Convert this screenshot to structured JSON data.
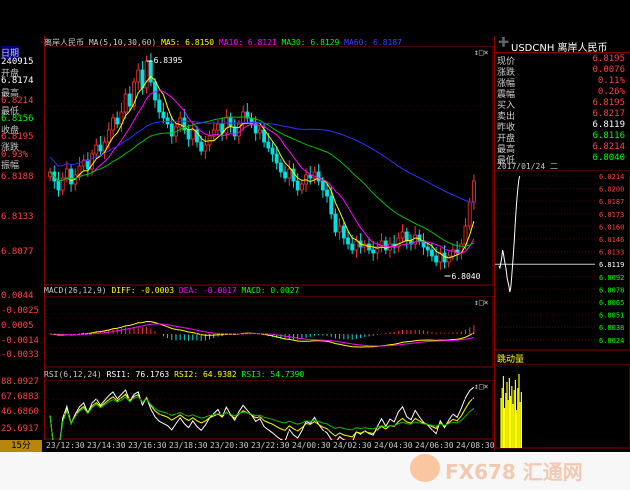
{
  "title_bar": {
    "symbol_name": "离岸人民币"
  },
  "main_header": {
    "name": "离岸人民币",
    "ma_params": "MA(5,10,30,60)",
    "ma5": "MA5: 6.8150",
    "ma10": "MA10: 6.8121",
    "ma30": "MA30: 6.8129",
    "ma60": "MA60: 6.8187"
  },
  "left_panel": {
    "date_label": "日期",
    "date_value": "240915",
    "open_label": "开盘",
    "open_value": "6.8174",
    "high_label": "最高",
    "high_value": "6.8214",
    "low_label": "最低",
    "low_value": "6.8156",
    "close_label": "收盘",
    "close_value": "6.8195",
    "change_label": "涨跌",
    "change_value": "0.93%",
    "amp_label": "振幅",
    "interval_label": "15分"
  },
  "chart_data": [
    {
      "type": "candlestick",
      "title": "离岸人民币",
      "ylim": [
        6.802,
        6.842
      ],
      "y_ticks": [
        "6.8188",
        "6.8133",
        "6.8077"
      ],
      "annotations": [
        {
          "text": "6.8395",
          "x_index": 23
        },
        {
          "text": "6.8040",
          "x_index": 94
        }
      ],
      "x": [
        "23/12:30",
        "23/14:30",
        "23/16:30",
        "23/18:30",
        "23/20:30",
        "23/22:30",
        "24/00:30",
        "24/02:30",
        "24/04:30",
        "24/06:30",
        "24/08:30"
      ],
      "close": [
        6.821,
        6.8195,
        6.818,
        6.82,
        6.8215,
        6.819,
        6.8205,
        6.822,
        6.823,
        6.8215,
        6.824,
        6.8255,
        6.8245,
        6.826,
        6.828,
        6.83,
        6.829,
        6.831,
        6.834,
        6.832,
        6.836,
        6.838,
        6.835,
        6.8395,
        6.836,
        6.833,
        6.831,
        6.83,
        6.829,
        6.827,
        6.8285,
        6.83,
        6.828,
        6.8265,
        6.828,
        6.826,
        6.8245,
        6.8255,
        6.827,
        6.828,
        6.829,
        6.8275,
        6.83,
        6.8285,
        6.827,
        6.829,
        6.831,
        6.83,
        6.829,
        6.8275,
        6.828,
        6.826,
        6.825,
        6.824,
        6.8225,
        6.821,
        6.82,
        6.8215,
        6.8195,
        6.818,
        6.819,
        6.8205,
        6.82,
        6.821,
        6.8195,
        6.818,
        6.817,
        6.814,
        6.811,
        6.812,
        6.81,
        6.809,
        6.808,
        6.8095,
        6.8085,
        6.809,
        6.808,
        6.8075,
        6.8085,
        6.8095,
        6.808,
        6.809,
        6.8085,
        6.81,
        6.811,
        6.8095,
        6.809,
        6.8105,
        6.8095,
        6.8085,
        6.808,
        6.807,
        6.806,
        6.8075,
        6.806,
        6.807,
        6.808,
        6.8075,
        6.809,
        6.812,
        6.816,
        6.8195
      ]
    },
    {
      "type": "line",
      "title": "MACD(26,12,9)",
      "series_labels": [
        "DIFF: -0.0003",
        "DEA: -0.0017",
        "MACD: 0.0027"
      ],
      "y_ticks": [
        "0.0044",
        "-0.0025",
        "0.0005",
        "-0.0014",
        "-0.0033"
      ]
    },
    {
      "type": "line",
      "title": "RSI(6,12,24)",
      "series_labels": [
        "RSI1: 76.1763",
        "RSI2: 64.9382",
        "RSI3: 54.7390"
      ],
      "y_ticks": [
        "88.0927",
        "67.6883",
        "46.6860",
        "25.6917"
      ]
    }
  ],
  "side_panel": {
    "title": "USDCNH 离岸人民币",
    "quotes": [
      {
        "label": "现价",
        "value": "6.8195",
        "color": "#ff4040"
      },
      {
        "label": "涨跌",
        "value": "0.0076",
        "color": "#ff4040"
      },
      {
        "label": "涨幅",
        "value": "0.11%",
        "color": "#ff4040"
      },
      {
        "label": "震幅",
        "value": "0.26%",
        "color": "#ff4040"
      },
      {
        "label": "买入",
        "value": "6.8195",
        "color": "#ff4040"
      },
      {
        "label": "卖出",
        "value": "6.8217",
        "color": "#ff4040"
      },
      {
        "label": "昨收",
        "value": "6.8119",
        "color": "#ffffff"
      },
      {
        "label": "开盘",
        "value": "6.8116",
        "color": "#00ff00"
      },
      {
        "label": "最高",
        "value": "6.8214",
        "color": "#ff4040"
      },
      {
        "label": "最低",
        "value": "6.8040",
        "color": "#00ff00"
      }
    ],
    "mini_date": "2017/01/24 二",
    "mini_ticks": [
      "6.0214",
      "6.0200",
      "6.0187",
      "6.0173",
      "6.0160",
      "6.0146",
      "6.0133",
      "6.8119",
      "6.8092",
      "6.8078",
      "6.8065",
      "6.8051",
      "6.8038",
      "6.8024"
    ],
    "volume_label": "跳动量"
  },
  "watermark": "FX678 汇通网"
}
